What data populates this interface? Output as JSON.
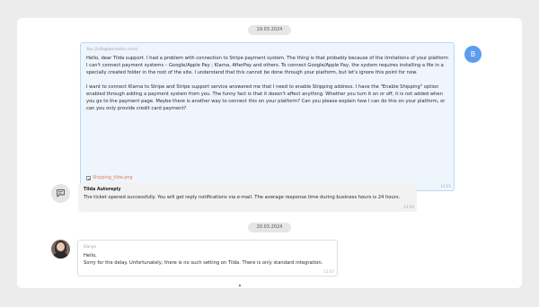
{
  "dates": [
    "19.03.2024",
    "20.03.2024"
  ],
  "user_message": {
    "avatar_letter": "B",
    "sender": "You (info@borkekin.com)",
    "paragraphs": [
      "Hello, dear Tilda support. I had a problem with connection to Stripe payment system. The thing is that probably because of the limitations of your platform I can't connect payment systems – Google/Apple Pay ; Klarna, AfterPay and others. To connect Google/Apple Pay, the system requires installing a file in a specially created folder in the root of the site. I understand that this cannot be done through your platform, but let's ignore this point for now.",
      "I want to connect Klarna to Stripe and Stripe support service answered me that I need to enable Shipping address. I have the \"Enable Shipping\" option enabled through adding a payment system from you. The funny fact is that it doesn't affect anything. Whether you turn it on or off, it is not added when you go to the payment page. Maybe there is another way to connect this on your platform? Can you please explain how I can do this on your platform, or can you only provide credit card payment?"
    ],
    "attachments": [
      "Shipping_tilda.png",
      "checkout1953.png"
    ],
    "time": "14:05"
  },
  "autoreply": {
    "icon": "chat-bubble-icon",
    "sender": "Tilda Autoreply",
    "text": "The ticket opened successfully. You will get reply notifications via e-mail. The average response time during business hours is 24 hours.",
    "time": "14:06"
  },
  "agent_message": {
    "sender": "Darya",
    "lines": [
      "Hello,",
      "Sorry for the delay. Unfortunately, there is no such setting on Tilda. There is only standard integration."
    ],
    "time": "12:07"
  }
}
